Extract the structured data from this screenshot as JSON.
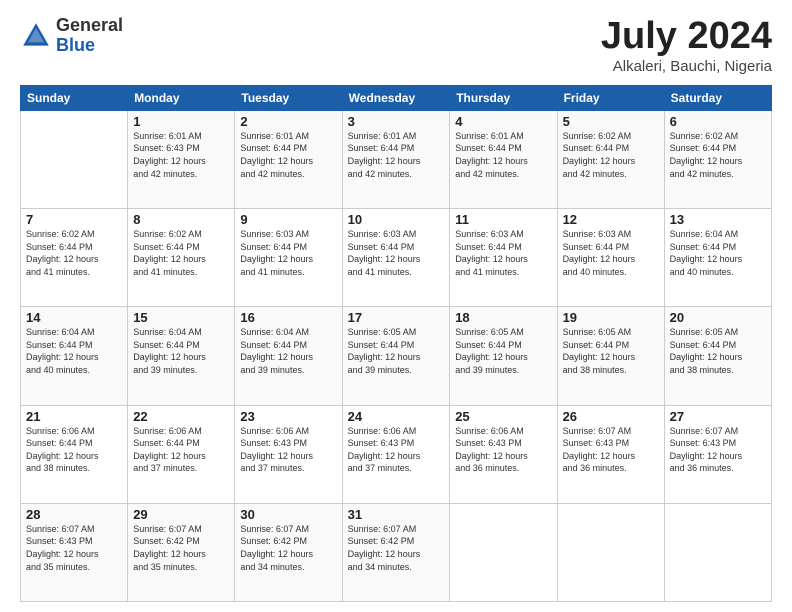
{
  "logo": {
    "general": "General",
    "blue": "Blue"
  },
  "title": {
    "month": "July 2024",
    "location": "Alkaleri, Bauchi, Nigeria"
  },
  "weekdays": [
    "Sunday",
    "Monday",
    "Tuesday",
    "Wednesday",
    "Thursday",
    "Friday",
    "Saturday"
  ],
  "weeks": [
    [
      {
        "day": "",
        "info": ""
      },
      {
        "day": "1",
        "info": "Sunrise: 6:01 AM\nSunset: 6:43 PM\nDaylight: 12 hours\nand 42 minutes."
      },
      {
        "day": "2",
        "info": "Sunrise: 6:01 AM\nSunset: 6:44 PM\nDaylight: 12 hours\nand 42 minutes."
      },
      {
        "day": "3",
        "info": "Sunrise: 6:01 AM\nSunset: 6:44 PM\nDaylight: 12 hours\nand 42 minutes."
      },
      {
        "day": "4",
        "info": "Sunrise: 6:01 AM\nSunset: 6:44 PM\nDaylight: 12 hours\nand 42 minutes."
      },
      {
        "day": "5",
        "info": "Sunrise: 6:02 AM\nSunset: 6:44 PM\nDaylight: 12 hours\nand 42 minutes."
      },
      {
        "day": "6",
        "info": "Sunrise: 6:02 AM\nSunset: 6:44 PM\nDaylight: 12 hours\nand 42 minutes."
      }
    ],
    [
      {
        "day": "7",
        "info": "Sunrise: 6:02 AM\nSunset: 6:44 PM\nDaylight: 12 hours\nand 41 minutes."
      },
      {
        "day": "8",
        "info": "Sunrise: 6:02 AM\nSunset: 6:44 PM\nDaylight: 12 hours\nand 41 minutes."
      },
      {
        "day": "9",
        "info": "Sunrise: 6:03 AM\nSunset: 6:44 PM\nDaylight: 12 hours\nand 41 minutes."
      },
      {
        "day": "10",
        "info": "Sunrise: 6:03 AM\nSunset: 6:44 PM\nDaylight: 12 hours\nand 41 minutes."
      },
      {
        "day": "11",
        "info": "Sunrise: 6:03 AM\nSunset: 6:44 PM\nDaylight: 12 hours\nand 41 minutes."
      },
      {
        "day": "12",
        "info": "Sunrise: 6:03 AM\nSunset: 6:44 PM\nDaylight: 12 hours\nand 40 minutes."
      },
      {
        "day": "13",
        "info": "Sunrise: 6:04 AM\nSunset: 6:44 PM\nDaylight: 12 hours\nand 40 minutes."
      }
    ],
    [
      {
        "day": "14",
        "info": "Sunrise: 6:04 AM\nSunset: 6:44 PM\nDaylight: 12 hours\nand 40 minutes."
      },
      {
        "day": "15",
        "info": "Sunrise: 6:04 AM\nSunset: 6:44 PM\nDaylight: 12 hours\nand 39 minutes."
      },
      {
        "day": "16",
        "info": "Sunrise: 6:04 AM\nSunset: 6:44 PM\nDaylight: 12 hours\nand 39 minutes."
      },
      {
        "day": "17",
        "info": "Sunrise: 6:05 AM\nSunset: 6:44 PM\nDaylight: 12 hours\nand 39 minutes."
      },
      {
        "day": "18",
        "info": "Sunrise: 6:05 AM\nSunset: 6:44 PM\nDaylight: 12 hours\nand 39 minutes."
      },
      {
        "day": "19",
        "info": "Sunrise: 6:05 AM\nSunset: 6:44 PM\nDaylight: 12 hours\nand 38 minutes."
      },
      {
        "day": "20",
        "info": "Sunrise: 6:05 AM\nSunset: 6:44 PM\nDaylight: 12 hours\nand 38 minutes."
      }
    ],
    [
      {
        "day": "21",
        "info": "Sunrise: 6:06 AM\nSunset: 6:44 PM\nDaylight: 12 hours\nand 38 minutes."
      },
      {
        "day": "22",
        "info": "Sunrise: 6:06 AM\nSunset: 6:44 PM\nDaylight: 12 hours\nand 37 minutes."
      },
      {
        "day": "23",
        "info": "Sunrise: 6:06 AM\nSunset: 6:43 PM\nDaylight: 12 hours\nand 37 minutes."
      },
      {
        "day": "24",
        "info": "Sunrise: 6:06 AM\nSunset: 6:43 PM\nDaylight: 12 hours\nand 37 minutes."
      },
      {
        "day": "25",
        "info": "Sunrise: 6:06 AM\nSunset: 6:43 PM\nDaylight: 12 hours\nand 36 minutes."
      },
      {
        "day": "26",
        "info": "Sunrise: 6:07 AM\nSunset: 6:43 PM\nDaylight: 12 hours\nand 36 minutes."
      },
      {
        "day": "27",
        "info": "Sunrise: 6:07 AM\nSunset: 6:43 PM\nDaylight: 12 hours\nand 36 minutes."
      }
    ],
    [
      {
        "day": "28",
        "info": "Sunrise: 6:07 AM\nSunset: 6:43 PM\nDaylight: 12 hours\nand 35 minutes."
      },
      {
        "day": "29",
        "info": "Sunrise: 6:07 AM\nSunset: 6:42 PM\nDaylight: 12 hours\nand 35 minutes."
      },
      {
        "day": "30",
        "info": "Sunrise: 6:07 AM\nSunset: 6:42 PM\nDaylight: 12 hours\nand 34 minutes."
      },
      {
        "day": "31",
        "info": "Sunrise: 6:07 AM\nSunset: 6:42 PM\nDaylight: 12 hours\nand 34 minutes."
      },
      {
        "day": "",
        "info": ""
      },
      {
        "day": "",
        "info": ""
      },
      {
        "day": "",
        "info": ""
      }
    ]
  ]
}
